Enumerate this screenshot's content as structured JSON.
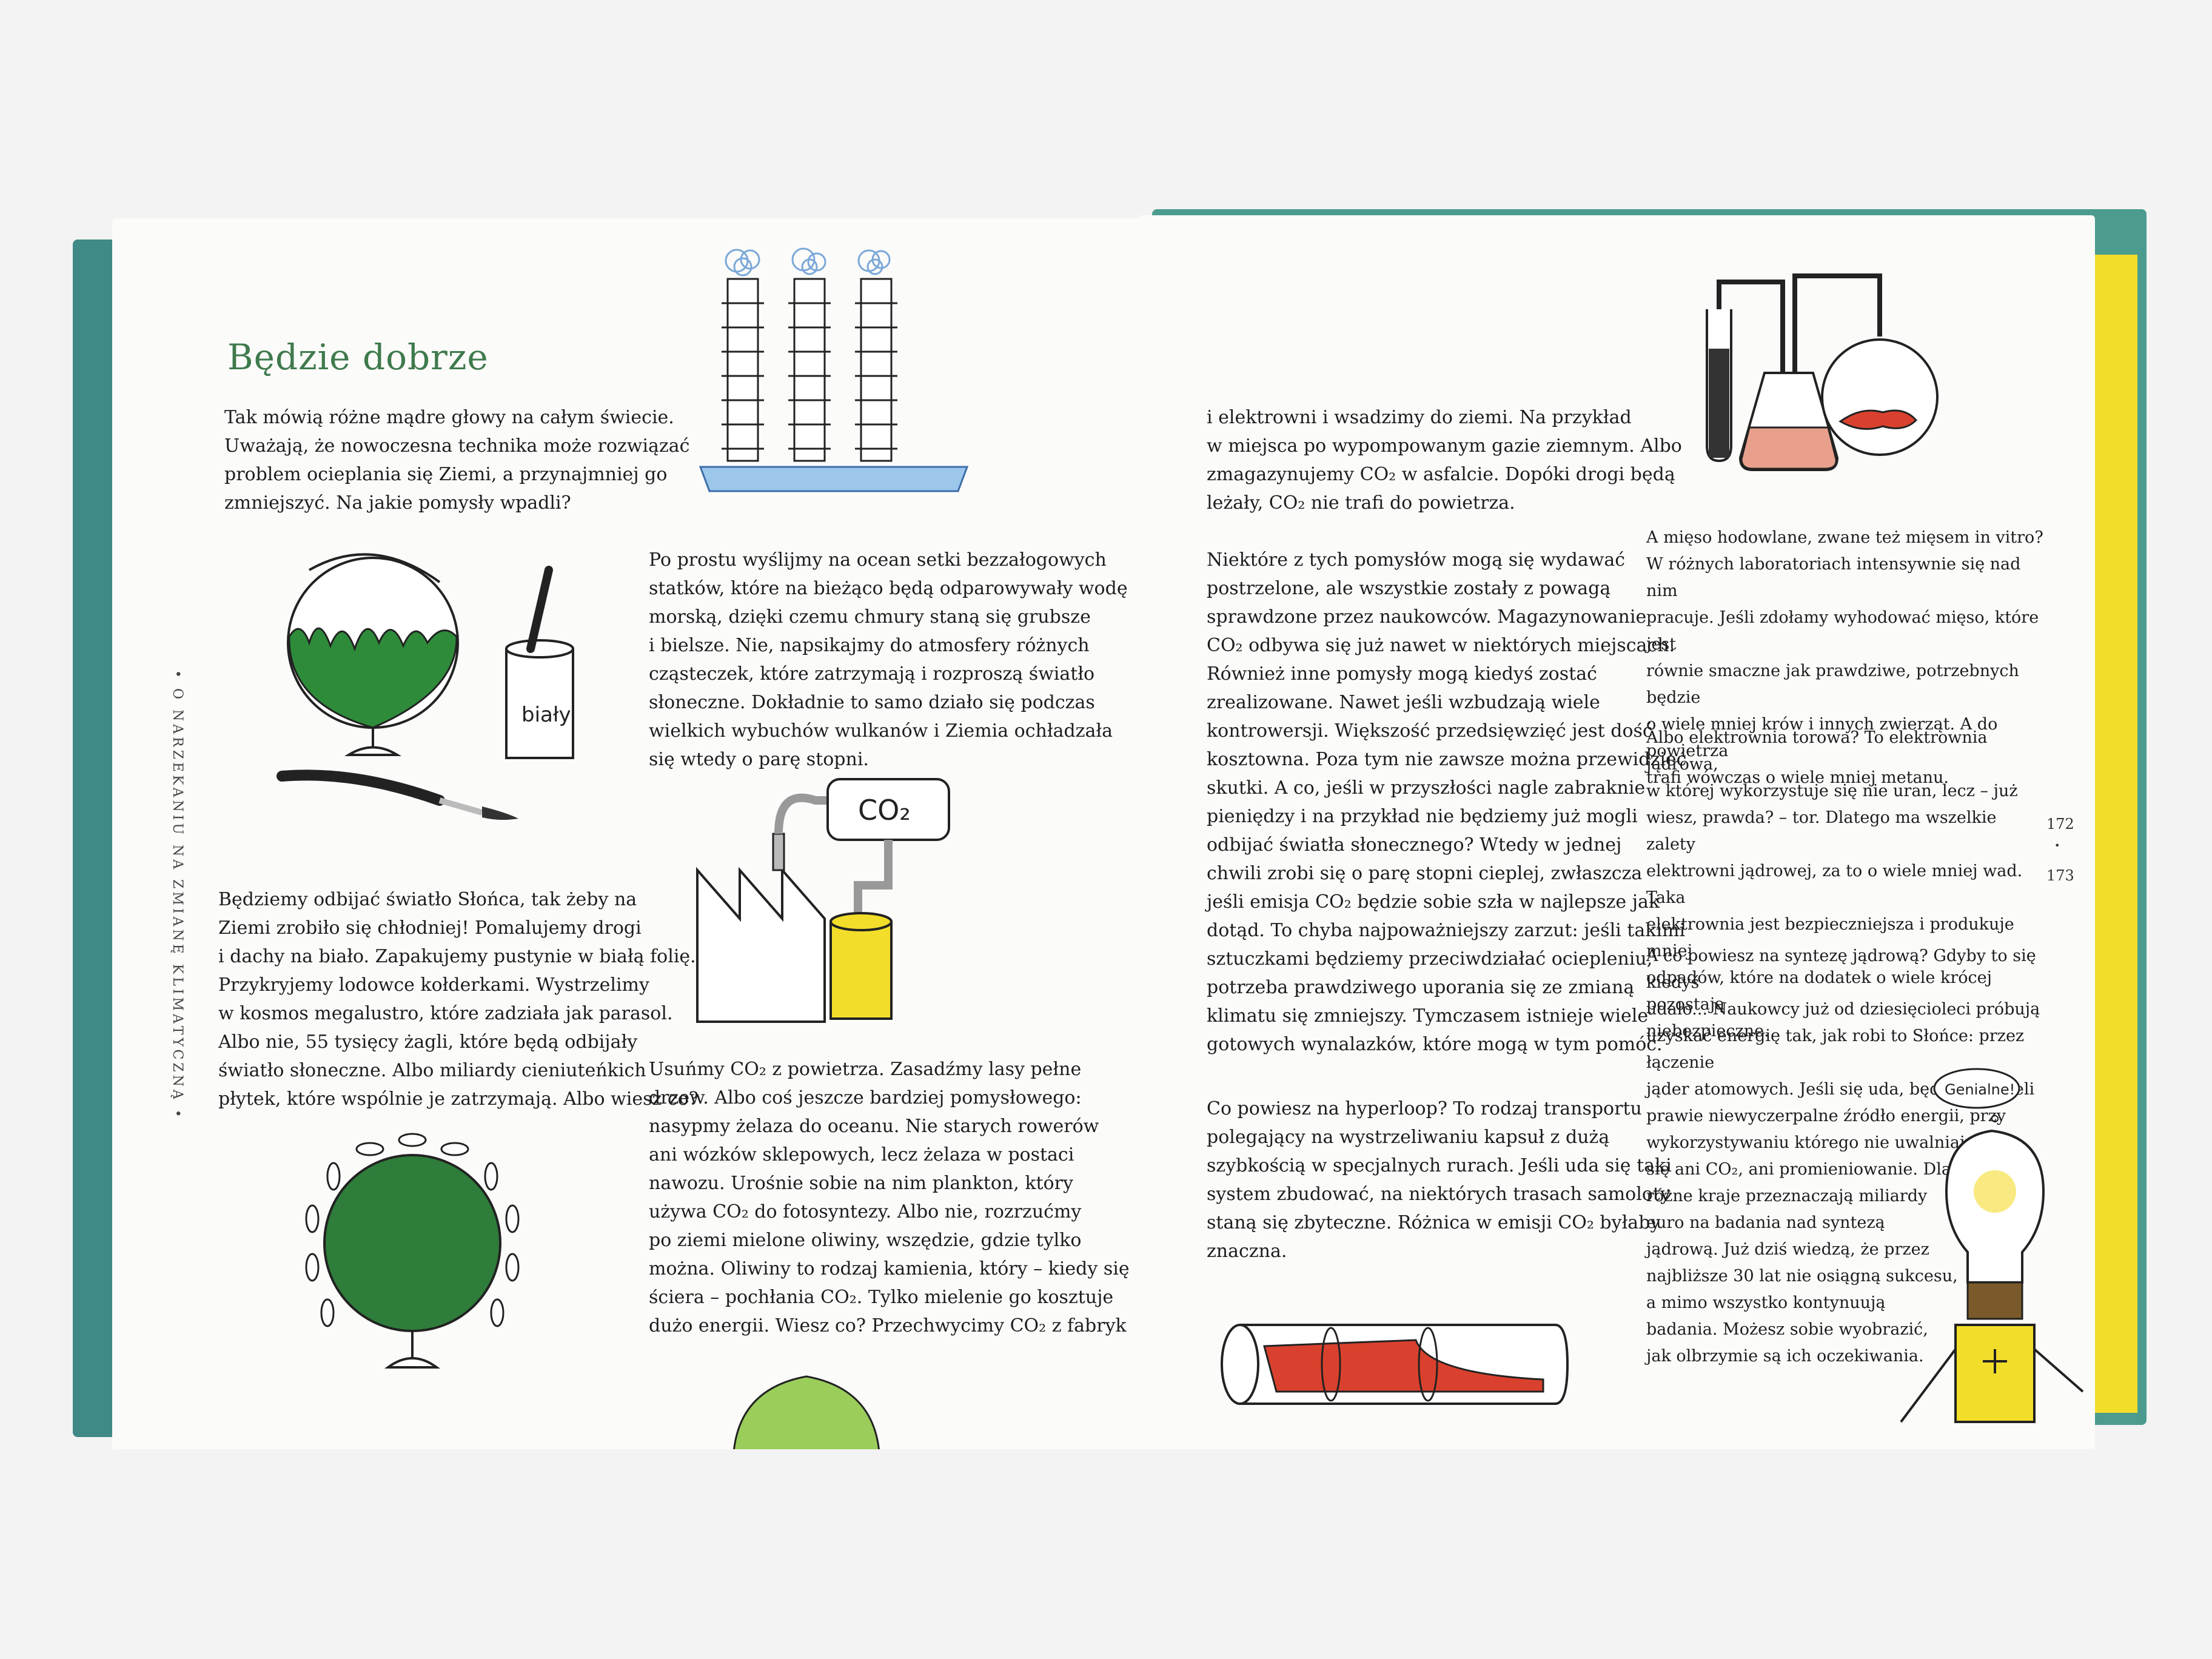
{
  "left_page": {
    "title": "Będzie dobrze",
    "side_label": "• O NARZEKANIU NA ZMIANĘ KLIMATYCZNĄ •",
    "para_intro": "Tak mówią różne mądre głowy na całym świecie.\nUważają, że nowoczesna technika może rozwiązać\nproblem ocieplania się Ziemi, a przynajmniej go\nzmniejszyć. Na jakie pomysły wpadli?",
    "para_reflect": "Będziemy odbijać światło Słońca, tak żeby na\nZiemi zrobiło się chłodniej! Pomalujemy drogi\ni dachy na biało. Zapakujemy pustynie w białą folię.\nPrzykryjemy lodowce kołderkami. Wystrzelimy\nw kosmos megalustro, które zadziała jak parasol.\nAlbo nie, 55 tysięcy żagli, które będą odbijały\nświatło słoneczne. Albo miliardy cieniuteńkich\npłytek, które wspólnie je zatrzymają. Albo wiesz co?",
    "para_ships": "Po prostu wyślijmy na ocean setki bezzałogowych\nstatków, które na bieżąco będą odparowywały wodę\nmorską, dzięki czemu chmury staną się grubsze\ni bielsze. Nie, napsikajmy do atmosfery różnych\ncząsteczek, które zatrzymają i rozproszą światło\nsłoneczne. Dokładnie to samo działo się podczas\nwielkich wybuchów wulkanów i Ziemia ochładzała\nsię wtedy o parę stopni.",
    "para_co2": "Usuńmy CO₂ z powietrza. Zasadźmy lasy pełne\ndrzew. Albo coś jeszcze bardziej pomysłowego:\nnasypmy żelaza do oceanu. Nie starych rowerów\nani wózków sklepowych, lecz żelaza w postaci\nnawozu. Urośnie sobie na nim plankton, który\nużywa CO₂ do fotosyntezy. Albo nie, rozrzućmy\npo ziemi mielone oliwiny, wszędzie, gdzie tylko\nmożna. Oliwiny to rodzaj kamienia, który – kiedy się\nściera – pochłania CO₂. Tylko mielenie go kosztuje\ndużo energii. Wiesz co? Przechwycimy CO₂ z fabryk",
    "paint_can_label": "biały",
    "tank_label": "CO₂"
  },
  "right_page": {
    "para_storage": "i elektrowni i wsadzimy do ziemi. Na przykład\nw miejsca po wypompowanym gazie ziemnym. Albo\nzmagazynujemy CO₂ w asfalcie. Dopóki drogi będą\nleżały, CO₂ nie trafi do powietrza.",
    "para_ideas": "Niektóre z tych pomysłów mogą się wydawać\npostrzelone, ale wszystkie zostały z powagą\nsprawdzone przez naukowców. Magazynowanie\nCO₂ odbywa się już nawet w niektórych miejscach.\nRównież inne pomysły mogą kiedyś zostać\nzrealizowane. Nawet jeśli wzbudzają wiele\nkontrowersji. Większość przedsięwzięć jest dość\nkosztowna. Poza tym nie zawsze można przewidzieć\nskutki. A co, jeśli w przyszłości nagle zabraknie\npieniędzy i na przykład nie będziemy już mogli\nodbijać światła słonecznego? Wtedy w jednej\nchwili zrobi się o parę stopni cieplej, zwłaszcza\njeśli emisja CO₂ będzie sobie szła w najlepsze jak\ndotąd. To chyba najpoważniejszy zarzut: jeśli takimi\nsztuczkami będziemy przeciwdziałać ociepleniu,\npotrzeba prawdziwego uporania się ze zmianą\nklimatu się zmniejszy. Tymczasem istnieje wiele\ngotowych wynalazków, które mogą w tym pomóc.",
    "para_hyperloop": "Co powiesz na hyperloop? To rodzaj transportu\npolegający na wystrzeliwaniu kapsuł z dużą\nszybkością w specjalnych rurach. Jeśli uda się taki\nsystem zbudować, na niektórych trasach samoloty\nstaną się zbyteczne. Różnica w emisji CO₂ byłaby\nznaczna.",
    "para_meat": "A mięso hodowlane, zwane też mięsem in vitro?\nW różnych laboratoriach intensywnie się nad nim\npracuje. Jeśli zdołamy wyhodować mięso, które jest\nrównie smaczne jak prawdziwe, potrzebnych będzie\no wiele mniej krów i innych zwierząt. A do powietrza\ntrafi wówczas o wiele mniej metanu.",
    "para_thorium": "Albo elektrownia torowa? To elektrownia jądrowa,\nw której wykorzystuje się nie uran, lecz – już\nwiesz, prawda? – tor. Dlatego ma wszelkie zalety\nelektrowni jądrowej, za to o wiele mniej wad. Taka\nelektrownia jest bezpieczniejsza i produkuje mniej\nodpadów, które na dodatek o wiele krócej pozostają\nniebezpieczne.",
    "para_fusion_a": "A co powiesz na syntezę jądrową? Gdyby to się kiedyś\nudało... Naukowcy już od dziesięcioleci próbują\nuzyskać energię tak, jak robi to Słońce: przez łączenie\njąder atomowych. Jeśli się uda, będziemy mieli\nprawie niewyczerpalne źródło energii, przy\nwykorzystywaniu którego nie uwalniają\nsię ani CO₂, ani promieniowanie. Dlatego\nróżne kraje przeznaczają miliardy\neuro na badania nad syntezą\njądrową. Już dziś wiedzą, że przez\nnajbliższe 30 lat nie osiągną sukcesu,\na mimo wszystko kontynuują\nbadania. Możesz sobie wyobrazić,\njak olbrzymie są ich oczekiwania.",
    "bulb_bubble": "Genialne!",
    "page_left_num": "172",
    "page_dot": "•",
    "page_right_num": "173"
  },
  "colors": {
    "title_green": "#3f7a4c",
    "globe_green": "#2e8b3a",
    "cover_teal": "#3f8a86",
    "yellow": "#f2de2a",
    "red": "#d9412e"
  }
}
